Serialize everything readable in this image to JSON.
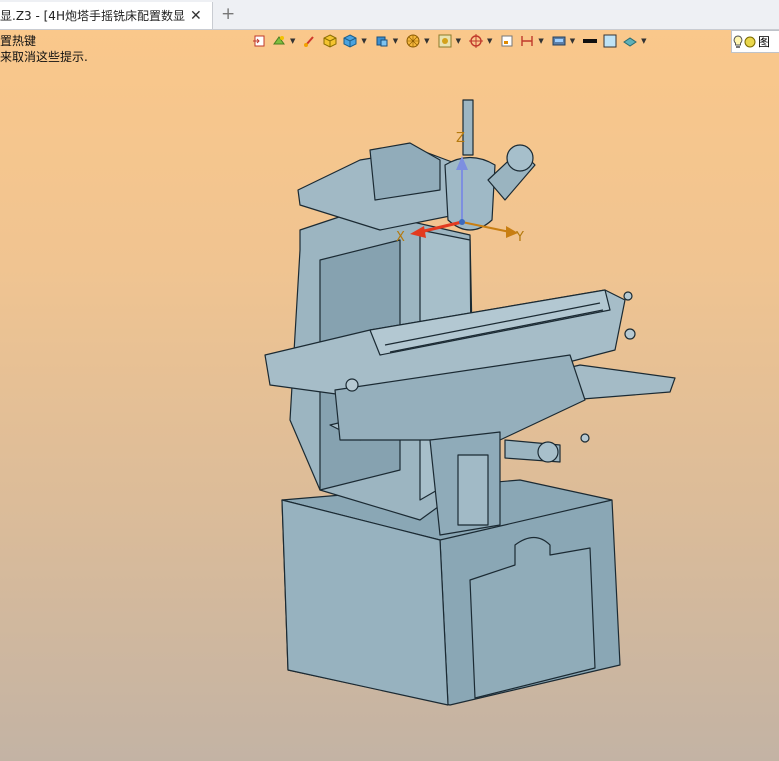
{
  "tab": {
    "title": "显.Z3 - [4H炮塔手摇铣床配置数显]"
  },
  "hints": {
    "line1": "置热键",
    "line2": "来取消这些提示."
  },
  "toolbar": {
    "icons": [
      "import-icon",
      "paint-icon",
      "brush-icon",
      "cube-icon",
      "box-icon",
      "solid-icon",
      "sphere-wire-icon",
      "frame-icon",
      "target-icon",
      "panel-icon",
      "dimension-icon",
      "layers-icon",
      "color-black-icon",
      "color-light-icon",
      "plane-icon",
      "bulb-icon"
    ],
    "right_label": "图"
  },
  "axes": {
    "x": "X",
    "y": "Y",
    "z": "Z"
  },
  "colors": {
    "model": "#8ea9b6",
    "model_edge": "#1b2a33",
    "x_axis": "#e33a1f",
    "y_axis": "#c87e12",
    "z_axis": "#7d8fe0"
  }
}
